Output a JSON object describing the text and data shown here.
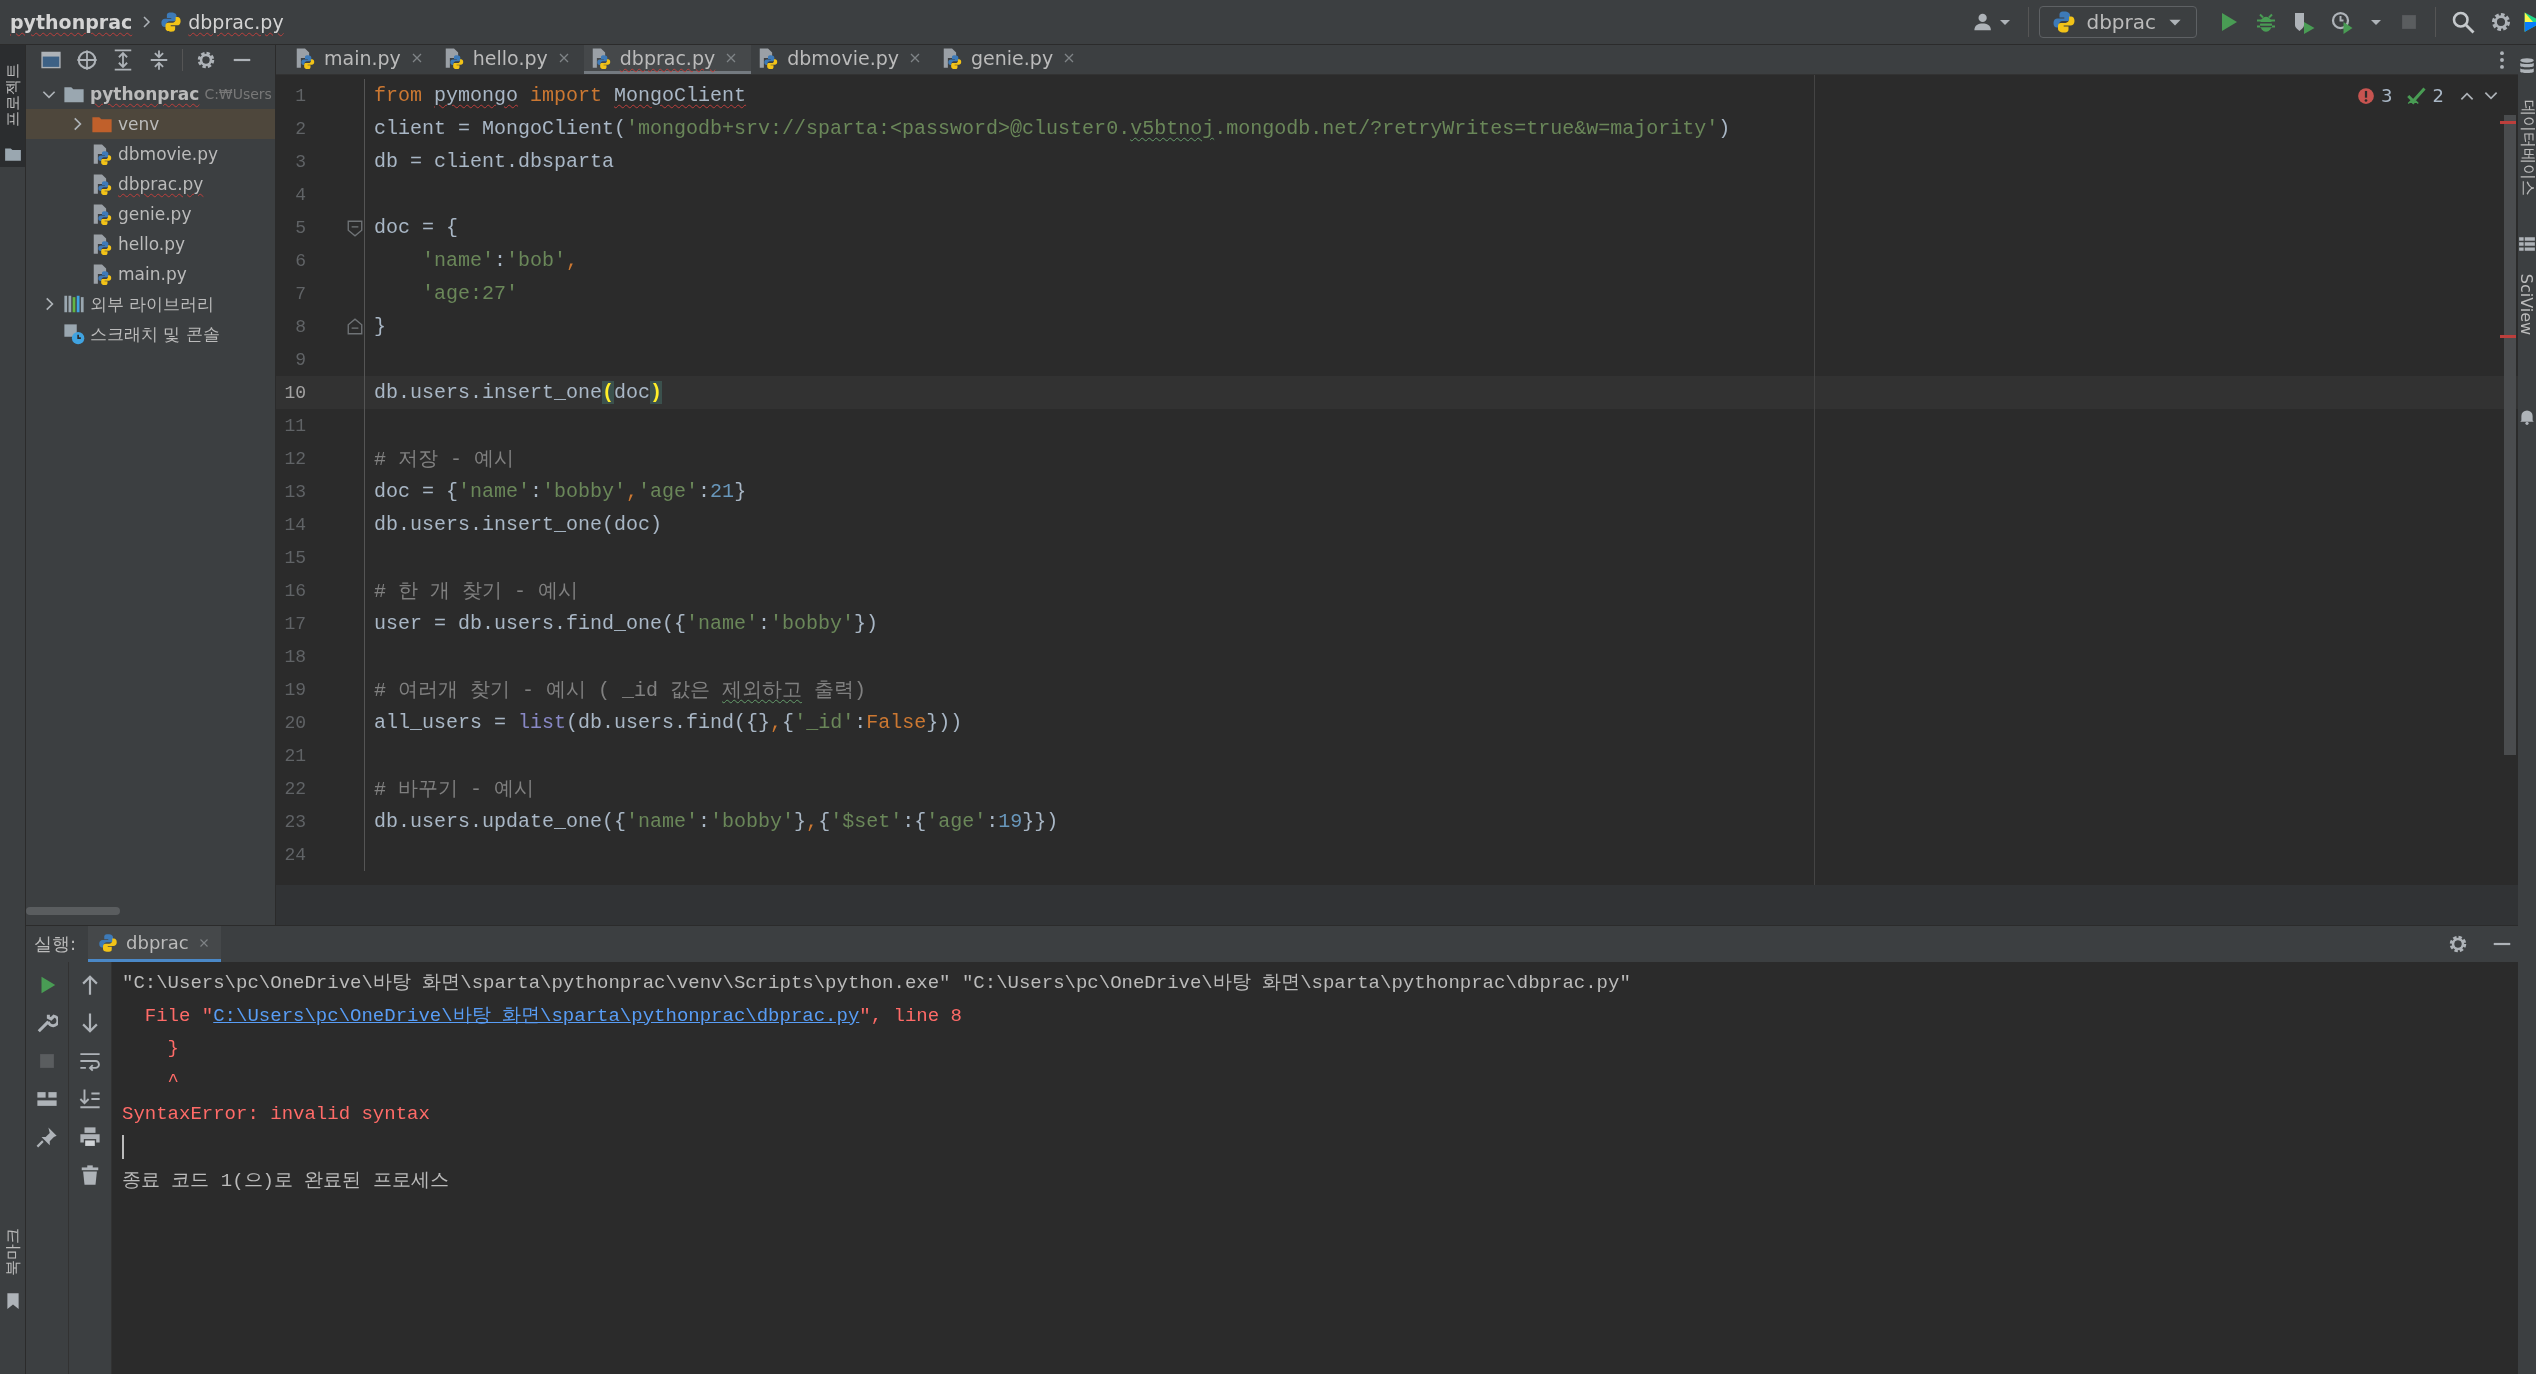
{
  "navbar": {
    "project": {
      "label": "pythonprac",
      "has_errors": true
    },
    "file": {
      "label": "dbprac.py",
      "has_errors": true
    },
    "run_config": "dbprac",
    "stop_disabled": true
  },
  "left_tool_windows": [
    {
      "label": "프로젝트",
      "selected": true,
      "at_bottom": false
    },
    {
      "label": "북마크",
      "selected": false,
      "at_bottom": true
    }
  ],
  "project_tree": [
    {
      "label": "pythonprac",
      "path": "C:₩Users",
      "kind": "folder",
      "expanded": true,
      "selected": false,
      "has_errors": true,
      "children": [
        {
          "label": "venv",
          "kind": "excluded-folder",
          "expanded": false,
          "selected": true,
          "has_errors": false
        },
        {
          "label": "dbmovie.py",
          "kind": "python-file",
          "selected": false,
          "has_errors": false
        },
        {
          "label": "dbprac.py",
          "kind": "python-file",
          "selected": false,
          "has_errors": true
        },
        {
          "label": "genie.py",
          "kind": "python-file",
          "selected": false,
          "has_errors": false
        },
        {
          "label": "hello.py",
          "kind": "python-file",
          "selected": false,
          "has_errors": false
        },
        {
          "label": "main.py",
          "kind": "python-file",
          "selected": false,
          "has_errors": false
        }
      ]
    },
    {
      "label": "외부 라이브러리",
      "kind": "library",
      "expanded": false,
      "selected": false,
      "has_errors": false
    },
    {
      "label": "스크래치 및 콘솔",
      "kind": "scratches",
      "selected": false,
      "has_errors": false
    }
  ],
  "tabs": [
    {
      "label": "main.py",
      "selected": false,
      "has_errors": false
    },
    {
      "label": "hello.py",
      "selected": false,
      "has_errors": false
    },
    {
      "label": "dbprac.py",
      "selected": true,
      "has_errors": true
    },
    {
      "label": "dbmovie.py",
      "selected": false,
      "has_errors": false
    },
    {
      "label": "genie.py",
      "selected": false,
      "has_errors": false
    }
  ],
  "inspections": {
    "errors": "3",
    "warnings": "2"
  },
  "editor": {
    "lines": [
      {
        "number": "1",
        "current": false,
        "tokens": [
          {
            "text": "from ",
            "kind": "keyword"
          },
          {
            "text": "pymongo",
            "kind": "plain",
            "error_underline": true
          },
          {
            "text": " import ",
            "kind": "keyword"
          },
          {
            "text": "MongoClient",
            "kind": "plain",
            "error_underline": true
          }
        ]
      },
      {
        "number": "2",
        "current": false,
        "tokens": [
          {
            "text": "client = MongoClient(",
            "kind": "plain"
          },
          {
            "text": "'mongodb+srv://sparta:<password>@cluster0.",
            "kind": "string"
          },
          {
            "text": "v5btnoj",
            "kind": "string",
            "typo_underline": true
          },
          {
            "text": ".mongodb.net/?retryWrites=true&w=majority'",
            "kind": "string"
          },
          {
            "text": ")",
            "kind": "plain"
          }
        ]
      },
      {
        "number": "3",
        "current": false,
        "tokens": [
          {
            "text": "db = client.dbsparta",
            "kind": "plain"
          }
        ]
      },
      {
        "number": "4",
        "current": false
      },
      {
        "number": "5",
        "current": false,
        "fold_start": true,
        "tokens": [
          {
            "text": "doc = {",
            "kind": "plain"
          }
        ]
      },
      {
        "number": "6",
        "current": false,
        "tokens": [
          {
            "text": "    'name'",
            "kind": "string"
          },
          {
            "text": ":",
            "kind": "plain"
          },
          {
            "text": "'bob'",
            "kind": "string"
          },
          {
            "text": ",",
            "kind": "keyword"
          }
        ]
      },
      {
        "number": "7",
        "current": false,
        "tokens": [
          {
            "text": "    'age:27'",
            "kind": "string"
          }
        ]
      },
      {
        "number": "8",
        "current": false,
        "fold_end": true,
        "tokens": [
          {
            "text": "}",
            "kind": "plain"
          }
        ]
      },
      {
        "number": "9",
        "current": false
      },
      {
        "number": "10",
        "current": true,
        "tokens": [
          {
            "text": "db.users.insert_one",
            "kind": "plain"
          },
          {
            "text": "(",
            "kind": "paren-match"
          },
          {
            "text": "doc",
            "kind": "plain"
          },
          {
            "text": ")",
            "kind": "paren-match"
          }
        ]
      },
      {
        "number": "11",
        "current": false
      },
      {
        "number": "12",
        "current": false,
        "tokens": [
          {
            "text": "# 저장 - 예시",
            "kind": "comment"
          }
        ]
      },
      {
        "number": "13",
        "current": false,
        "tokens": [
          {
            "text": "doc = {",
            "kind": "plain"
          },
          {
            "text": "'name'",
            "kind": "string"
          },
          {
            "text": ":",
            "kind": "plain"
          },
          {
            "text": "'bobby'",
            "kind": "string"
          },
          {
            "text": ",",
            "kind": "keyword"
          },
          {
            "text": "'age'",
            "kind": "string"
          },
          {
            "text": ":",
            "kind": "plain"
          },
          {
            "text": "21",
            "kind": "number"
          },
          {
            "text": "}",
            "kind": "plain"
          }
        ]
      },
      {
        "number": "14",
        "current": false,
        "tokens": [
          {
            "text": "db.users.insert_one(doc)",
            "kind": "plain"
          }
        ]
      },
      {
        "number": "15",
        "current": false
      },
      {
        "number": "16",
        "current": false,
        "tokens": [
          {
            "text": "# 한 개 찾기 - 예시",
            "kind": "comment"
          }
        ]
      },
      {
        "number": "17",
        "current": false,
        "tokens": [
          {
            "text": "user = db.users.find_one({",
            "kind": "plain"
          },
          {
            "text": "'name'",
            "kind": "string"
          },
          {
            "text": ":",
            "kind": "plain"
          },
          {
            "text": "'bobby'",
            "kind": "string"
          },
          {
            "text": "})",
            "kind": "plain"
          }
        ]
      },
      {
        "number": "18",
        "current": false
      },
      {
        "number": "19",
        "current": false,
        "tokens": [
          {
            "text": "# 여러개 찾기 - 예시 ( _id 값은 ",
            "kind": "comment"
          },
          {
            "text": "제외하고",
            "kind": "comment",
            "typo_underline": true
          },
          {
            "text": " 출력)",
            "kind": "comment"
          }
        ]
      },
      {
        "number": "20",
        "current": false,
        "tokens": [
          {
            "text": "all_users = ",
            "kind": "plain"
          },
          {
            "text": "list",
            "kind": "builtin"
          },
          {
            "text": "(db.users.find({}",
            "kind": "plain"
          },
          {
            "text": ",",
            "kind": "keyword"
          },
          {
            "text": "{",
            "kind": "plain"
          },
          {
            "text": "'_id'",
            "kind": "string"
          },
          {
            "text": ":",
            "kind": "plain"
          },
          {
            "text": "False",
            "kind": "keyword"
          },
          {
            "text": "}))",
            "kind": "plain"
          }
        ]
      },
      {
        "number": "21",
        "current": false
      },
      {
        "number": "22",
        "current": false,
        "tokens": [
          {
            "text": "# 바꾸기 - 예시",
            "kind": "comment"
          }
        ]
      },
      {
        "number": "23",
        "current": false,
        "tokens": [
          {
            "text": "db.users.update_one({",
            "kind": "plain"
          },
          {
            "text": "'name'",
            "kind": "string"
          },
          {
            "text": ":",
            "kind": "plain"
          },
          {
            "text": "'bobby'",
            "kind": "string"
          },
          {
            "text": "}",
            "kind": "plain"
          },
          {
            "text": ",",
            "kind": "keyword"
          },
          {
            "text": "{",
            "kind": "plain"
          },
          {
            "text": "'$set'",
            "kind": "string"
          },
          {
            "text": ":{",
            "kind": "plain"
          },
          {
            "text": "'age'",
            "kind": "string"
          },
          {
            "text": ":",
            "kind": "plain"
          },
          {
            "text": "19",
            "kind": "number"
          },
          {
            "text": "}})",
            "kind": "plain"
          }
        ]
      },
      {
        "number": "24",
        "current": false
      }
    ]
  },
  "run_panel": {
    "label": "실행:",
    "tabs": [
      {
        "label": "dbprac",
        "selected": true
      }
    ],
    "stop_disabled": true,
    "output": [
      {
        "kind": "text",
        "segments": [
          {
            "text": "\"C:\\Users\\pc\\OneDrive\\바탕 화면\\sparta\\pythonprac\\venv\\Scripts\\python.exe\" \"C:\\Users\\pc\\OneDrive\\바탕 화면\\sparta\\pythonprac\\dbprac.py\"",
            "kind": "normal"
          }
        ]
      },
      {
        "kind": "text",
        "segments": [
          {
            "text": "  File \"",
            "kind": "error"
          },
          {
            "text": "C:\\Users\\pc\\OneDrive\\바탕 화면\\sparta\\pythonprac\\dbprac.py",
            "kind": "link"
          },
          {
            "text": "\", line 8",
            "kind": "error"
          }
        ]
      },
      {
        "kind": "text",
        "segments": [
          {
            "text": "    }",
            "kind": "error"
          }
        ]
      },
      {
        "kind": "text",
        "segments": [
          {
            "text": "    ^",
            "kind": "error"
          }
        ]
      },
      {
        "kind": "text",
        "segments": [
          {
            "text": "SyntaxError: invalid syntax",
            "kind": "error"
          }
        ]
      },
      {
        "kind": "cursor"
      },
      {
        "kind": "text",
        "segments": [
          {
            "text": "종료 코드 1(으)로 완료된 프로세스",
            "kind": "normal"
          }
        ]
      }
    ]
  },
  "right_tool_windows": [
    {
      "label": "데이터베이스"
    },
    {
      "label": "SciView"
    }
  ]
}
